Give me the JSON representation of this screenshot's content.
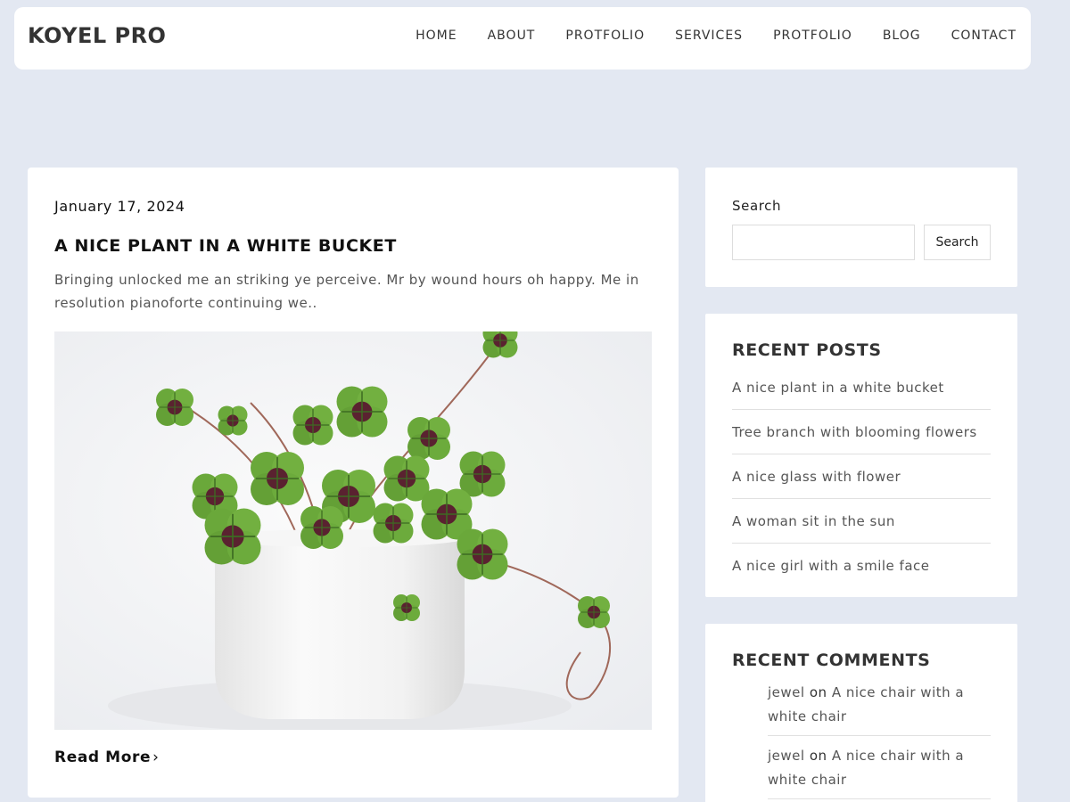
{
  "header": {
    "logo": "KOYEL PRO",
    "nav": [
      "HOME",
      "ABOUT",
      "PROTFOLIO",
      "SERVICES",
      "PROTFOLIO",
      "BLOG",
      "CONTACT"
    ]
  },
  "post": {
    "date": "January 17, 2024",
    "title": "A NICE PLANT IN A WHITE BUCKET",
    "excerpt": "Bringing unlocked me an striking ye perceive. Mr by wound hours oh happy. Me in resolution pianoforte continuing we..",
    "read_more": "Read More",
    "read_more_icon": "chevron-right-icon"
  },
  "sidebar": {
    "search": {
      "label": "Search",
      "placeholder": "",
      "value": "",
      "button": "Search"
    },
    "recent_posts": {
      "title": "RECENT POSTS",
      "items": [
        "A nice plant in a white bucket",
        "Tree branch with blooming flowers",
        "A nice glass with flower",
        "A woman sit in the sun",
        "A nice girl with a smile face"
      ]
    },
    "recent_comments": {
      "title": "RECENT COMMENTS",
      "items": [
        {
          "author": "jewel",
          "on": "on",
          "post": "A nice chair with a white chair"
        },
        {
          "author": "jewel",
          "on": "on",
          "post": "A nice chair with a white chair"
        }
      ]
    }
  },
  "colors": {
    "page_background": "#e3e8f2",
    "card_background": "#ffffff",
    "heading": "#333333",
    "body_text": "#555555",
    "leaf_green": "#6aa83a",
    "leaf_center": "#5a2230"
  }
}
